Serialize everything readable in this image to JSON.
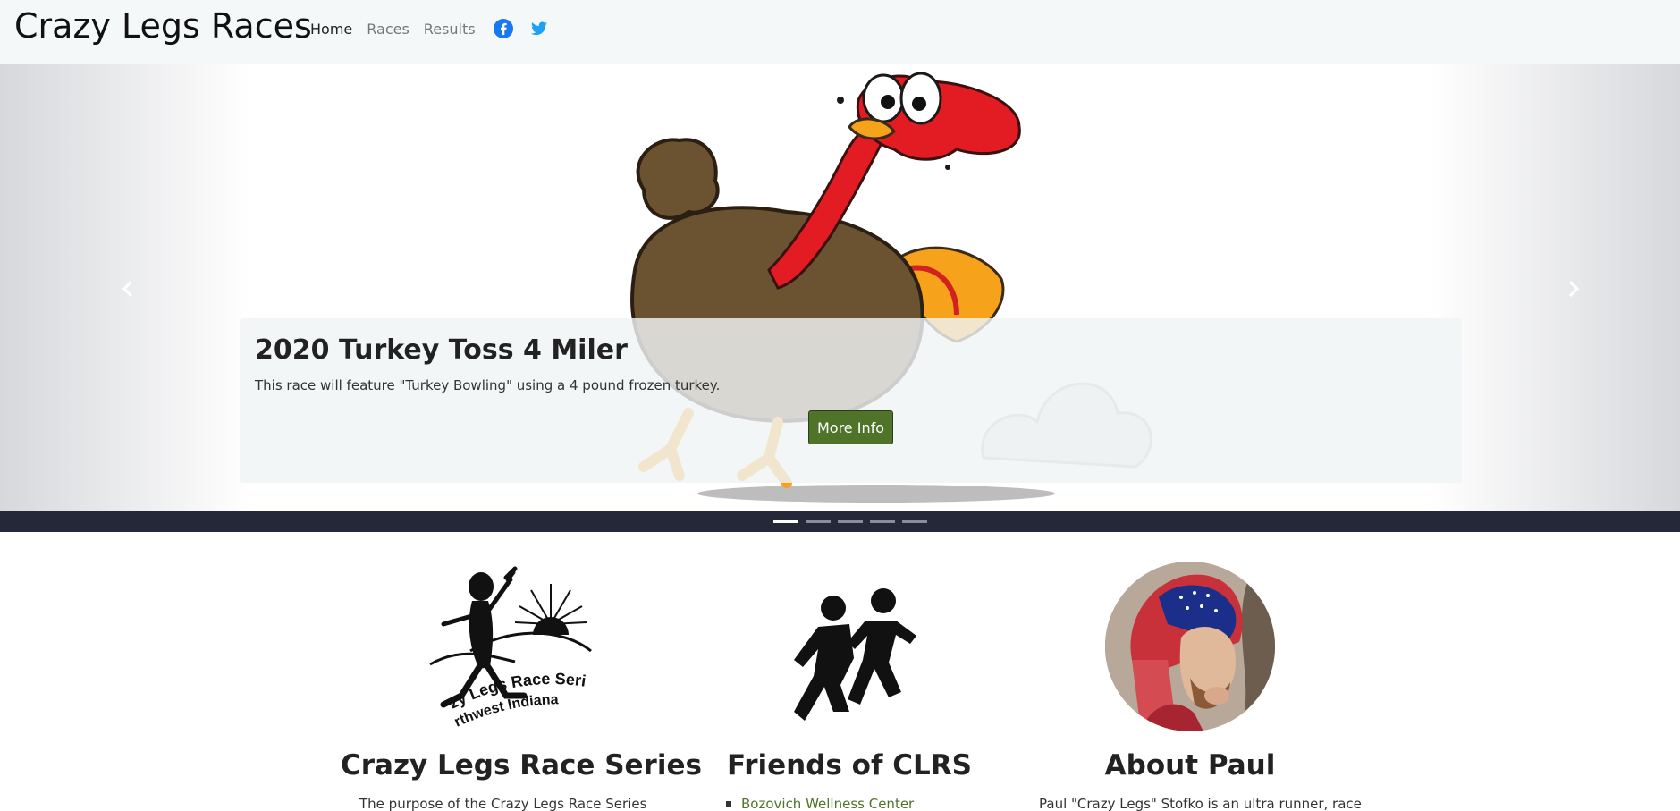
{
  "navbar": {
    "brand": "Crazy Legs Races",
    "links": [
      {
        "label": "Home",
        "active": true
      },
      {
        "label": "Races",
        "active": false
      },
      {
        "label": "Results",
        "active": false
      }
    ],
    "social": [
      {
        "icon": "facebook-icon",
        "color": "#1877f2"
      },
      {
        "icon": "twitter-icon",
        "color": "#1da1f2"
      }
    ]
  },
  "carousel": {
    "slide_title": "2020 Turkey Toss 4 Miler",
    "slide_text": "This race will feature \"Turkey Bowling\" using a 4 pound frozen turkey.",
    "button_label": "More Info",
    "prev_icon": "chevron-left-icon",
    "next_icon": "chevron-right-icon",
    "indicator_count": 5,
    "active_index": 0
  },
  "features": {
    "series": {
      "heading": "Crazy Legs Race Series",
      "text": "The purpose of the Crazy Legs Race Series",
      "logo_text_1": "zy Legs Race Series",
      "logo_text_2": "rthwest Indiana"
    },
    "friends": {
      "heading": "Friends of CLRS",
      "items": [
        "Bozovich Wellness Center"
      ]
    },
    "about": {
      "heading": "About Paul",
      "text": "Paul \"Crazy Legs\" Stofko is an ultra runner, race"
    }
  },
  "colors": {
    "accent": "#4f7429",
    "navbar_bg": "#f4f8f9",
    "indicator_bar": "#252838"
  }
}
